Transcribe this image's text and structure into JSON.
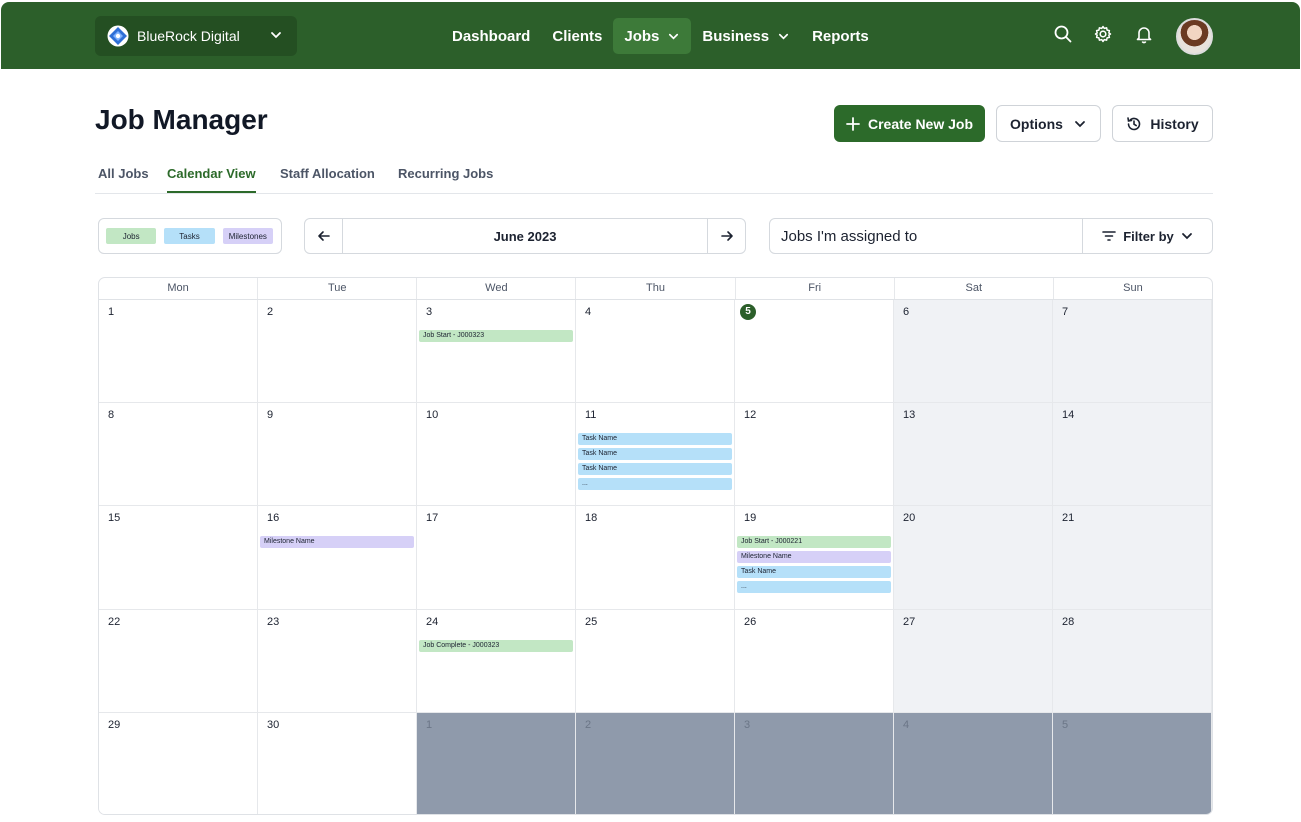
{
  "colors": {
    "brand": "#2c5f2a",
    "job": "#c2e7c4",
    "task": "#b5e0f9",
    "milestone": "#d6d0f7",
    "other_month": "#8f9aab"
  },
  "nav": {
    "workspace": "BlueRock Digital",
    "items": [
      {
        "label": "Dashboard",
        "active": false
      },
      {
        "label": "Clients",
        "active": false
      },
      {
        "label": "Jobs",
        "active": true,
        "dropdown": true
      },
      {
        "label": "Business",
        "active": false,
        "dropdown": true
      },
      {
        "label": "Reports",
        "active": false
      }
    ],
    "icons": [
      "search-icon",
      "gear-icon",
      "bell-icon"
    ]
  },
  "page": {
    "title": "Job Manager"
  },
  "buttons": {
    "create": "Create New Job",
    "options": "Options",
    "history": "History"
  },
  "tabs": [
    {
      "label": "All Jobs",
      "active": false
    },
    {
      "label": "Calendar View",
      "active": true
    },
    {
      "label": "Staff Allocation",
      "active": false
    },
    {
      "label": "Recurring Jobs",
      "active": false
    }
  ],
  "legend": {
    "jobs": "Jobs",
    "tasks": "Tasks",
    "milestones": "Milestones"
  },
  "calendar": {
    "month_label": "June 2023",
    "weekdays": [
      "Mon",
      "Tue",
      "Wed",
      "Thu",
      "Fri",
      "Sat",
      "Sun"
    ],
    "weeks": [
      [
        {
          "day": "1"
        },
        {
          "day": "2"
        },
        {
          "day": "3",
          "events": [
            {
              "type": "job",
              "label": "Job Start - J000323"
            }
          ]
        },
        {
          "day": "4"
        },
        {
          "day": "5",
          "today": true
        },
        {
          "day": "6",
          "weekend": true
        },
        {
          "day": "7",
          "weekend": true
        }
      ],
      [
        {
          "day": "8"
        },
        {
          "day": "9"
        },
        {
          "day": "10"
        },
        {
          "day": "11",
          "events": [
            {
              "type": "task",
              "label": "Task Name"
            },
            {
              "type": "task",
              "label": "Task Name"
            },
            {
              "type": "task",
              "label": "Task Name"
            },
            {
              "type": "task",
              "label": "..."
            }
          ]
        },
        {
          "day": "12"
        },
        {
          "day": "13",
          "weekend": true
        },
        {
          "day": "14",
          "weekend": true
        }
      ],
      [
        {
          "day": "15"
        },
        {
          "day": "16",
          "events": [
            {
              "type": "milestone",
              "label": "Milestone Name"
            }
          ]
        },
        {
          "day": "17"
        },
        {
          "day": "18"
        },
        {
          "day": "19",
          "events": [
            {
              "type": "job",
              "label": "Job Start - J000221"
            },
            {
              "type": "milestone",
              "label": "Milestone Name"
            },
            {
              "type": "task",
              "label": "Task Name"
            },
            {
              "type": "task",
              "label": "..."
            }
          ]
        },
        {
          "day": "20",
          "weekend": true
        },
        {
          "day": "21",
          "weekend": true
        }
      ],
      [
        {
          "day": "22"
        },
        {
          "day": "23"
        },
        {
          "day": "24",
          "events": [
            {
              "type": "job",
              "label": "Job Complete - J000323"
            }
          ]
        },
        {
          "day": "25"
        },
        {
          "day": "26"
        },
        {
          "day": "27",
          "weekend": true
        },
        {
          "day": "28",
          "weekend": true
        }
      ],
      [
        {
          "day": "29"
        },
        {
          "day": "30"
        },
        {
          "day": "1",
          "other": true
        },
        {
          "day": "2",
          "other": true
        },
        {
          "day": "3",
          "other": true
        },
        {
          "day": "4",
          "other": true
        },
        {
          "day": "5",
          "other": true
        }
      ]
    ]
  },
  "filters": {
    "assigned": "Jobs I'm assigned to",
    "filter_by": "Filter by"
  }
}
